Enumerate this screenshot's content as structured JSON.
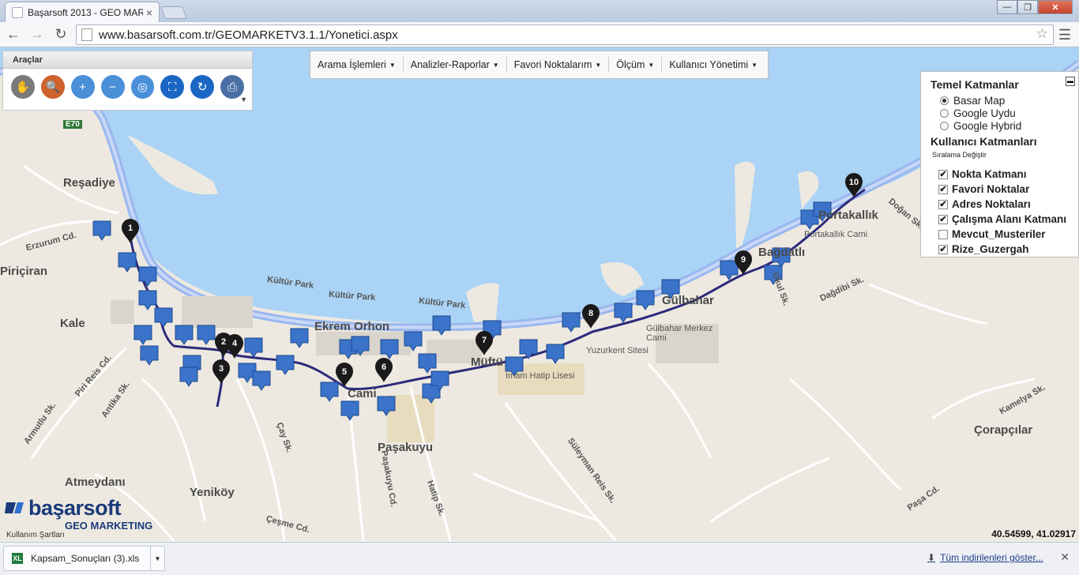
{
  "browser": {
    "tab_title": "Başarsoft 2013 - GEO MAR",
    "tab_close": "×",
    "url": "www.basarsoft.com.tr/GEOMARKETV3.1.1/Yonetici.aspx",
    "window_buttons": [
      "—",
      "❐",
      "✕"
    ]
  },
  "araclar": {
    "title": "Araçlar",
    "tools": [
      {
        "icon": "pan-icon",
        "glyph": "✋",
        "color": "#7a7a7a"
      },
      {
        "icon": "search-icon",
        "glyph": "🔍",
        "color": "#d0622d"
      },
      {
        "icon": "zoom-in-icon",
        "glyph": "+",
        "color": "#4a90d9"
      },
      {
        "icon": "zoom-out-icon",
        "glyph": "−",
        "color": "#4a90d9"
      },
      {
        "icon": "zoom-extent-icon",
        "glyph": "◎",
        "color": "#4a90d9"
      },
      {
        "icon": "fullscreen-icon",
        "glyph": "⛶",
        "color": "#1a66c4"
      },
      {
        "icon": "refresh-icon",
        "glyph": "↻",
        "color": "#1a66c4"
      },
      {
        "icon": "print-icon",
        "glyph": "⎙",
        "color": "#4a6fa5"
      }
    ]
  },
  "menu": {
    "items": [
      "Arama İşlemleri",
      "Analizler-Raporlar",
      "Favori Noktalarım",
      "Ölçüm",
      "Kullanıcı Yönetimi"
    ]
  },
  "layers": {
    "base_title": "Temel Katmanlar",
    "base_options": [
      {
        "label": "Basar Map",
        "selected": true
      },
      {
        "label": "Google Uydu",
        "selected": false
      },
      {
        "label": "Google Hybrid",
        "selected": false
      }
    ],
    "user_title": "Kullanıcı Katmanları",
    "order_change": "Sıralama Değiştir",
    "user_layers": [
      {
        "label": "Nokta Katmanı",
        "checked": true
      },
      {
        "label": "Favori Noktalar",
        "checked": true
      },
      {
        "label": "Adres Noktaları",
        "checked": true
      },
      {
        "label": "Çalışma Alanı Katmanı",
        "checked": true
      },
      {
        "label": "Mevcut_Musteriler",
        "checked": false
      },
      {
        "label": "Rize_Guzergah",
        "checked": true
      }
    ]
  },
  "map": {
    "labels": [
      "Reşadiye",
      "Kale",
      "Ekrem Orhon",
      "Gülbahar",
      "Portakallık",
      "Bağdatlı",
      "Paşakuyu",
      "Atmeydanı",
      "Yeniköy",
      "Çorapçılar",
      "Müftü",
      "Cami",
      "Piriçiran",
      "E70"
    ],
    "streets": [
      "Kültür Park",
      "Kültür Park",
      "Kültür Park",
      "Erzurum Cd.",
      "Piri Reis Cd.",
      "Armutlu Sk.",
      "Antika Sk.",
      "Paşakuyu Cd.",
      "Hatip Sk.",
      "Süleyman Reis Sk.",
      "Okul Sk.",
      "Dağdibi Sk.",
      "Doğan Sk.",
      "Kamelya Sk.",
      "Paşa Cd.",
      "Çeşme Cd.",
      "Çay Sk."
    ],
    "pois": [
      "Portakallık Cami",
      "Gülbahar Merkez Cami",
      "İmam Hatip Lisesi",
      "Yuzurkent Sitesi"
    ],
    "route_stops": [
      "1",
      "2",
      "3",
      "4",
      "5",
      "6",
      "7",
      "8",
      "9",
      "10"
    ]
  },
  "logo": {
    "brand": "başarsoft",
    "product": "GEO MARKETING"
  },
  "terms": "Kullanım Şartları",
  "coords": "40.54599, 41.02917",
  "downloads": {
    "file": "Kapsam_Sonuçları (3).xls",
    "show_all": "Tüm indirilenleri göster...",
    "file_icon": "XL"
  }
}
